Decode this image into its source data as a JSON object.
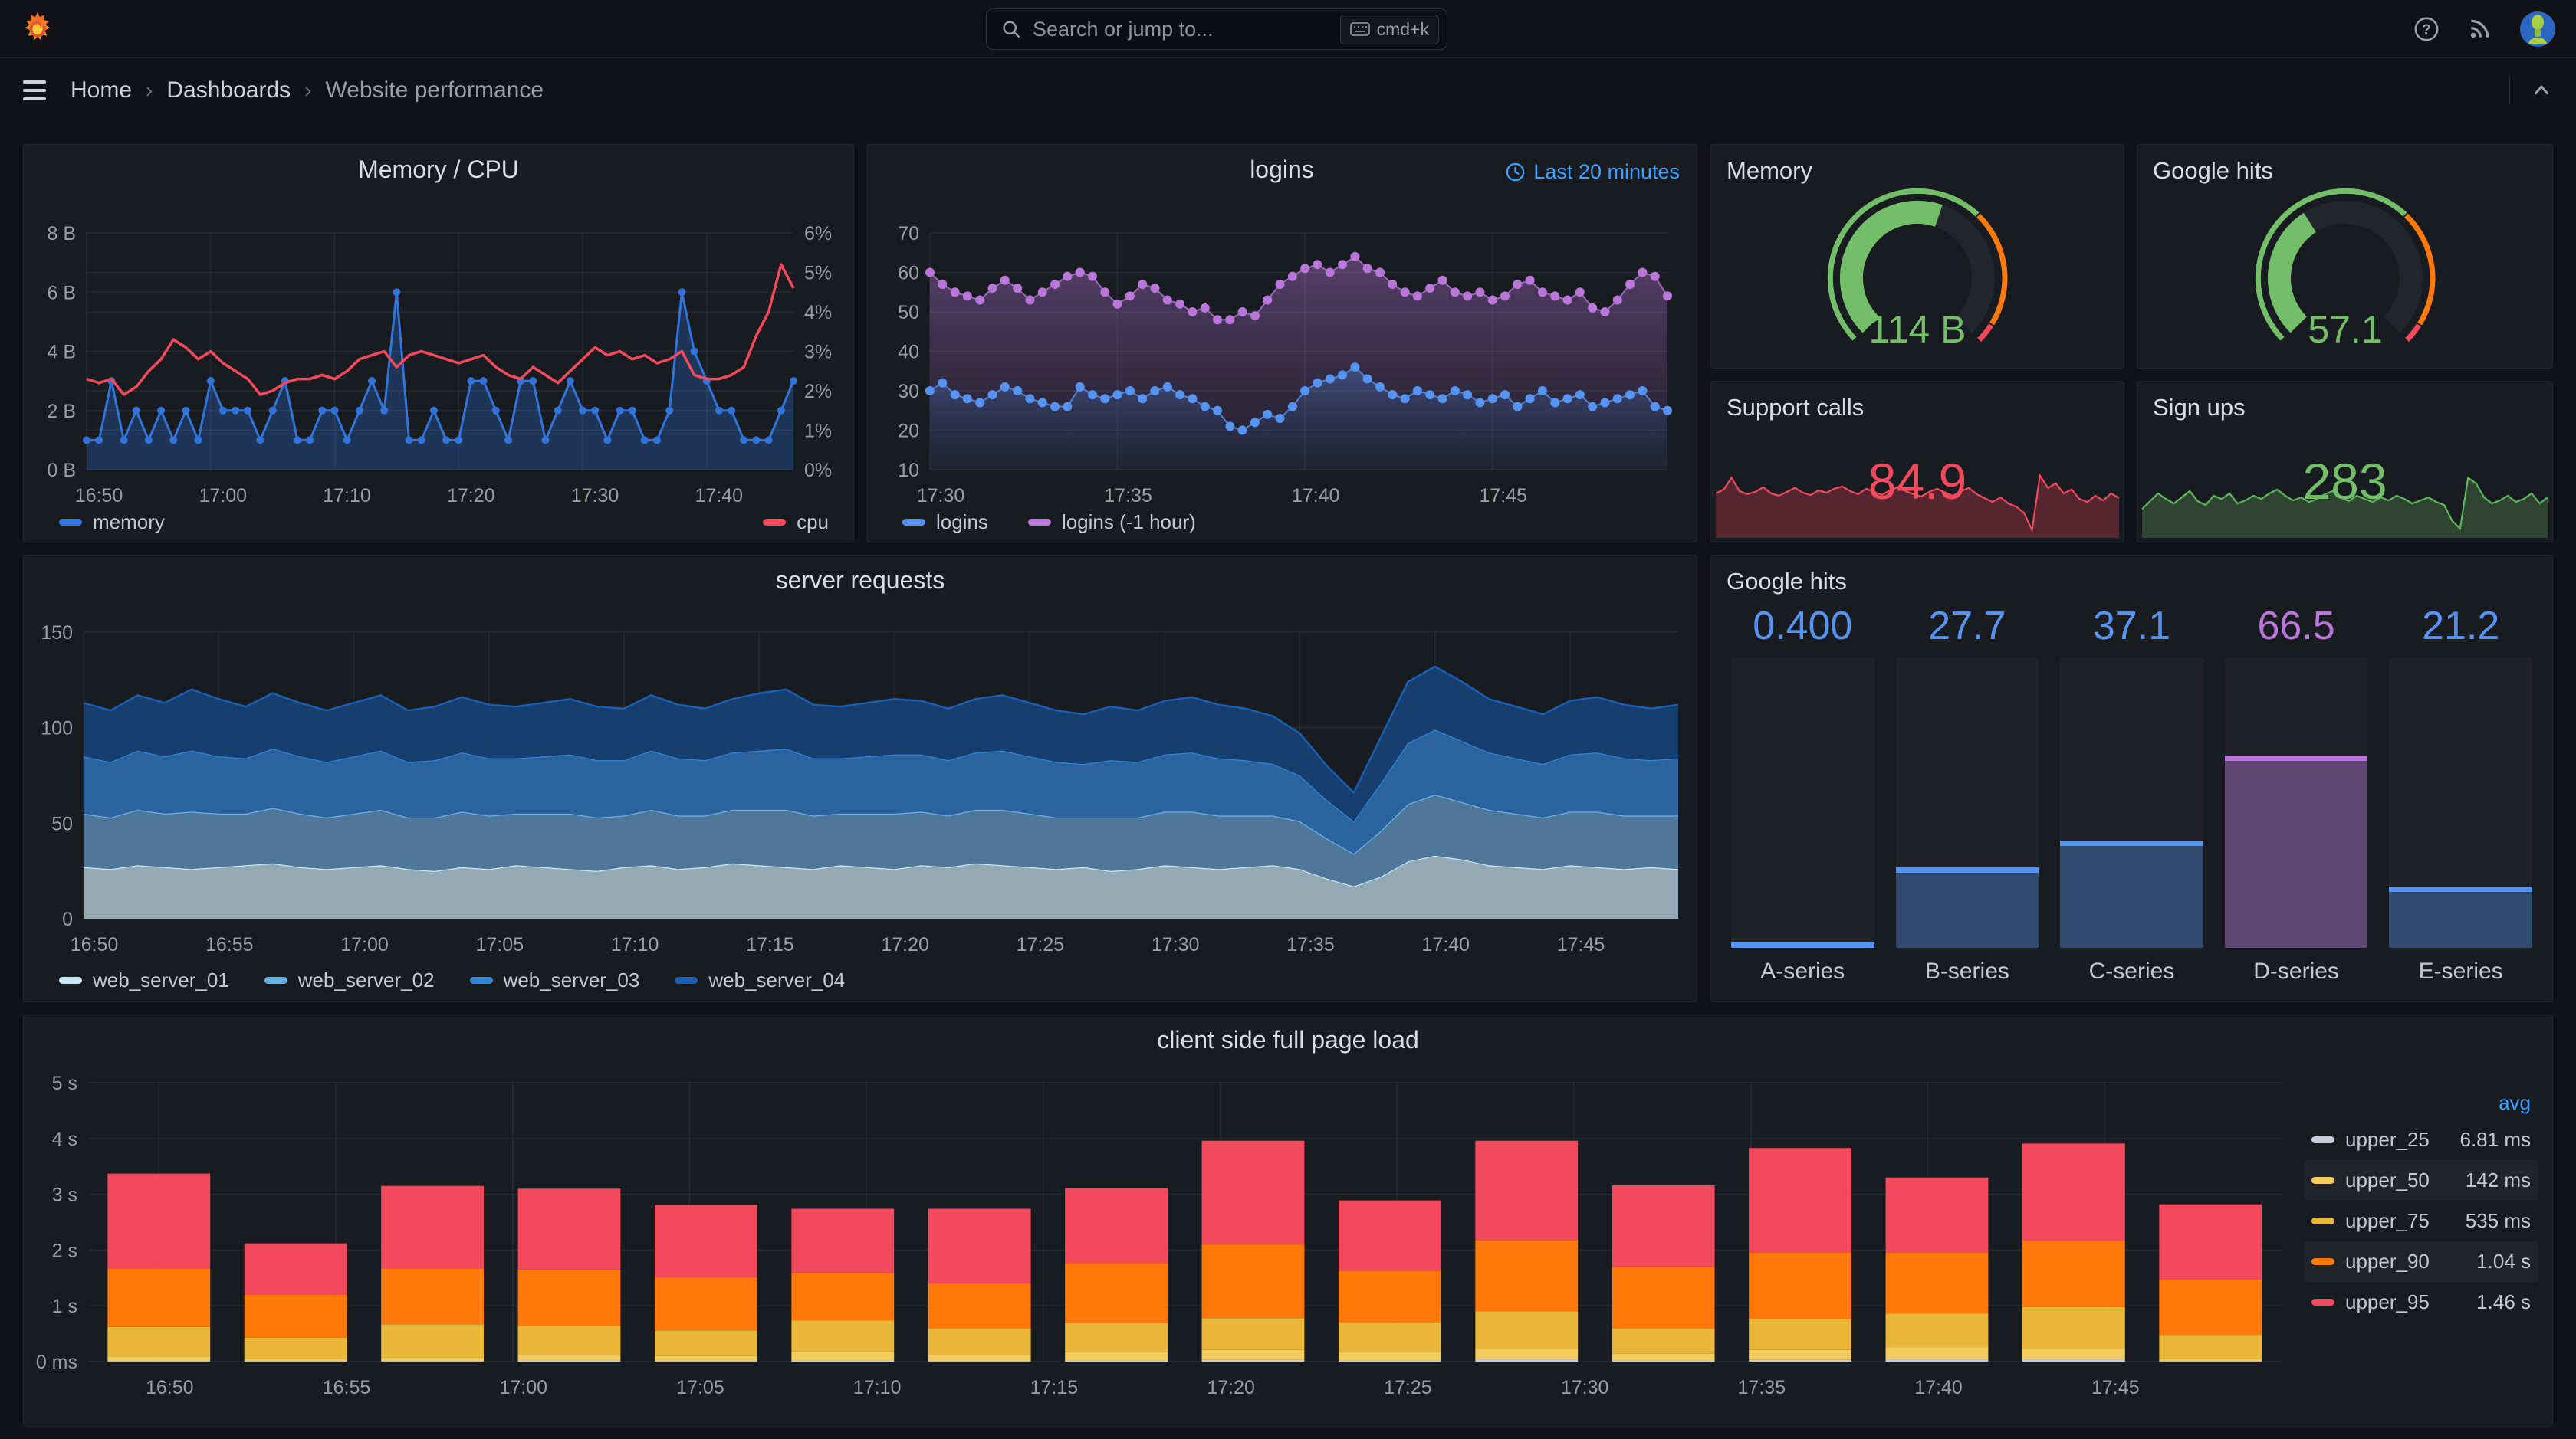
{
  "nav": {
    "search_placeholder": "Search or jump to...",
    "shortcut": "cmd+k"
  },
  "breadcrumb": {
    "sep": "›",
    "items": [
      "Home",
      "Dashboards",
      "Website performance"
    ]
  },
  "colors": {
    "page_bg": "#111217",
    "panel_bg": "#181B1F",
    "panel_border": "#25262C",
    "text": "#D8D9DA",
    "text_dim": "#9A9DA6",
    "grid": "rgba(204,204,220,0.09)",
    "link_blue": "#3CA1FF",
    "blue": "#3274D9",
    "light_blue": "#5794F2",
    "purple": "#B877D9",
    "red": "#F2495C",
    "green": "#73BF69",
    "orange": "#FF780A",
    "yellow": "#EAB839",
    "pale_yellow": "#F2CC5C",
    "pale": "#CCCCDC"
  },
  "panels": {
    "memcpu": {
      "title": "Memory / CPU",
      "legend": [
        {
          "label": "memory",
          "color": "#3274D9"
        },
        {
          "label": "cpu",
          "color": "#F2495C"
        }
      ]
    },
    "logins": {
      "title": "logins",
      "time_range": "Last 20 minutes",
      "legend": [
        {
          "label": "logins",
          "color": "#5794F2"
        },
        {
          "label": "logins (-1 hour)",
          "color": "#B877D9"
        }
      ]
    },
    "memory_gauge": {
      "title": "Memory",
      "value": "114 B"
    },
    "google_gauge": {
      "title": "Google hits",
      "value": "57.1"
    },
    "support_calls": {
      "title": "Support calls",
      "value": "84.9"
    },
    "sign_ups": {
      "title": "Sign ups",
      "value": "283"
    },
    "server_requests": {
      "title": "server requests",
      "legend": [
        {
          "label": "web_server_01",
          "color": "#C9E6F5"
        },
        {
          "label": "web_server_02",
          "color": "#68B2E8"
        },
        {
          "label": "web_server_03",
          "color": "#3186D6"
        },
        {
          "label": "web_server_04",
          "color": "#1B5FB0"
        }
      ]
    },
    "google_bars": {
      "title": "Google hits"
    },
    "client_load": {
      "title": "client side full page load",
      "legend_header": "avg",
      "legend": [
        {
          "label": "upper_25",
          "value": "6.81 ms",
          "color": "#CCCCDC",
          "zebra": false
        },
        {
          "label": "upper_50",
          "value": "142 ms",
          "color": "#F2CC5C",
          "zebra": true
        },
        {
          "label": "upper_75",
          "value": "535 ms",
          "color": "#EAB839",
          "zebra": false
        },
        {
          "label": "upper_90",
          "value": "1.04 s",
          "color": "#FF780A",
          "zebra": true
        },
        {
          "label": "upper_95",
          "value": "1.46 s",
          "color": "#F2495C",
          "zebra": false
        }
      ]
    }
  },
  "chart_data": {
    "memcpu": {
      "type": "line",
      "title": "Memory / CPU",
      "x_ticks": {
        "idx": [
          0,
          10,
          20,
          30,
          40,
          50
        ],
        "labels": [
          "16:50",
          "17:00",
          "17:10",
          "17:20",
          "17:30",
          "17:40"
        ]
      },
      "y_left": {
        "min": 0,
        "max": 8,
        "tick_labels": [
          "0 B",
          "2 B",
          "4 B",
          "6 B",
          "8 B"
        ]
      },
      "y_right": {
        "min": 0,
        "max": 6,
        "tick_labels": [
          "0%",
          "1%",
          "2%",
          "3%",
          "4%",
          "5%",
          "6%"
        ]
      },
      "series": [
        {
          "name": "memory",
          "unit": "B",
          "axis": "left",
          "color": "#3274D9",
          "fill": "rgba(50,116,217,0.30)",
          "values": [
            1,
            1,
            3,
            1,
            2,
            1,
            2,
            1,
            2,
            1,
            3,
            2,
            2,
            2,
            1,
            2,
            3,
            1,
            1,
            2,
            2,
            1,
            2,
            3,
            2,
            6,
            1,
            1,
            2,
            1,
            1,
            3,
            3,
            2,
            1,
            3,
            3,
            1,
            2,
            3,
            2,
            2,
            1,
            2,
            2,
            1,
            1,
            2,
            6,
            4,
            3,
            2,
            2,
            1,
            1,
            1,
            2,
            3
          ]
        },
        {
          "name": "cpu",
          "unit": "%",
          "axis": "right",
          "color": "#F2495C",
          "values": [
            2.3,
            2.2,
            2.3,
            1.9,
            2.1,
            2.5,
            2.8,
            3.3,
            3.1,
            2.8,
            3.0,
            2.7,
            2.5,
            2.3,
            1.9,
            2.0,
            2.2,
            2.3,
            2.3,
            2.4,
            2.3,
            2.5,
            2.8,
            2.9,
            3.0,
            2.6,
            2.9,
            3.0,
            2.9,
            2.8,
            2.7,
            2.8,
            2.9,
            2.6,
            2.4,
            2.3,
            2.6,
            2.4,
            2.2,
            2.5,
            2.8,
            3.1,
            2.9,
            3.0,
            2.8,
            2.9,
            2.7,
            2.8,
            3.0,
            2.4,
            2.3,
            2.3,
            2.4,
            2.6,
            3.4,
            4.0,
            5.2,
            4.6
          ]
        }
      ]
    },
    "logins": {
      "type": "points",
      "title": "logins",
      "x_ticks": {
        "idx": [
          0,
          15,
          30,
          45
        ],
        "labels": [
          "17:30",
          "17:35",
          "17:40",
          "17:45"
        ]
      },
      "y": {
        "min": 10,
        "max": 70,
        "tick_labels": [
          "10",
          "20",
          "30",
          "40",
          "50",
          "60",
          "70"
        ]
      },
      "series": [
        {
          "name": "logins (-1 hour)",
          "color": "#B877D9",
          "values": [
            60,
            57,
            55,
            54,
            53,
            56,
            58,
            56,
            53,
            55,
            57,
            59,
            60,
            59,
            55,
            52,
            54,
            57,
            56,
            53,
            52,
            50,
            51,
            48,
            48,
            50,
            49,
            53,
            57,
            59,
            61,
            62,
            60,
            62,
            64,
            61,
            60,
            57,
            55,
            54,
            56,
            58,
            55,
            54,
            55,
            53,
            54,
            57,
            58,
            55,
            54,
            53,
            55,
            51,
            50,
            53,
            57,
            60,
            59,
            54
          ]
        },
        {
          "name": "logins",
          "color": "#5794F2",
          "values": [
            30,
            32,
            29,
            28,
            27,
            29,
            31,
            30,
            28,
            27,
            26,
            26,
            31,
            29,
            28,
            29,
            30,
            28,
            30,
            31,
            29,
            28,
            26,
            25,
            21,
            20,
            22,
            24,
            23,
            26,
            30,
            32,
            33,
            34,
            36,
            33,
            31,
            29,
            28,
            30,
            29,
            28,
            30,
            29,
            27,
            28,
            29,
            26,
            28,
            30,
            27,
            28,
            29,
            26,
            27,
            28,
            29,
            30,
            26,
            25
          ]
        }
      ]
    },
    "memory_gauge": {
      "type": "gauge",
      "display": "114 B",
      "percent": 0.57,
      "color": "#73BF69",
      "thresholds": [
        {
          "upTo": 0.66,
          "color": "#73BF69"
        },
        {
          "upTo": 0.95,
          "color": "#FF780A"
        },
        {
          "upTo": 1.0,
          "color": "#F2495C"
        }
      ]
    },
    "google_gauge": {
      "type": "gauge",
      "display": "57.1",
      "percent": 0.38,
      "color": "#73BF69",
      "thresholds": [
        {
          "upTo": 0.66,
          "color": "#73BF69"
        },
        {
          "upTo": 0.95,
          "color": "#FF780A"
        },
        {
          "upTo": 1.0,
          "color": "#F2495C"
        }
      ]
    },
    "support_calls": {
      "type": "sparkline",
      "color": "#F2495C",
      "fill": "rgba(242,73,92,0.28)",
      "values": [
        55,
        60,
        75,
        58,
        54,
        57,
        63,
        55,
        52,
        57,
        62,
        56,
        53,
        59,
        56,
        61,
        64,
        58,
        54,
        61,
        57,
        53,
        59,
        63,
        58,
        54,
        51,
        57,
        61,
        56,
        52,
        58,
        62,
        54,
        49,
        44,
        50,
        42,
        38,
        30,
        8,
        78,
        62,
        68,
        55,
        60,
        48,
        44,
        52,
        46,
        55,
        49
      ]
    },
    "sign_ups": {
      "type": "sparkline",
      "color": "#5CB85C",
      "fill": "rgba(115,191,105,0.25)",
      "values": [
        35,
        45,
        55,
        48,
        42,
        50,
        58,
        45,
        40,
        52,
        48,
        55,
        42,
        46,
        52,
        48,
        55,
        60,
        52,
        46,
        50,
        44,
        48,
        54,
        58,
        50,
        45,
        52,
        48,
        44,
        50,
        46,
        52,
        48,
        42,
        46,
        50,
        44,
        40,
        20,
        10,
        75,
        68,
        50,
        42,
        46,
        52,
        44,
        48,
        55,
        42,
        50
      ]
    },
    "server_requests": {
      "type": "stacked_area",
      "title": "server requests",
      "x_ticks": {
        "idx": [
          0,
          5,
          10,
          15,
          20,
          25,
          30,
          35,
          40,
          45,
          50,
          55
        ],
        "labels": [
          "16:50",
          "16:55",
          "17:00",
          "17:05",
          "17:10",
          "17:15",
          "17:20",
          "17:25",
          "17:30",
          "17:35",
          "17:40",
          "17:45"
        ]
      },
      "y": {
        "min": 0,
        "max": 150,
        "tick_labels": [
          "0",
          "50",
          "100",
          "150"
        ]
      },
      "series": [
        {
          "name": "web_server_01",
          "line": "#C9E6F5",
          "fill": "#93A9B6",
          "values": [
            27,
            26,
            28,
            27,
            26,
            27,
            28,
            29,
            27,
            26,
            27,
            28,
            26,
            25,
            27,
            26,
            28,
            27,
            26,
            25,
            27,
            28,
            26,
            27,
            29,
            28,
            27,
            26,
            28,
            27,
            26,
            28,
            27,
            29,
            28,
            27,
            26,
            27,
            25,
            26,
            28,
            27,
            26,
            27,
            28,
            26,
            21,
            17,
            22,
            30,
            33,
            31,
            28,
            27,
            26,
            28,
            27,
            26,
            27,
            26
          ]
        },
        {
          "name": "web_server_02",
          "line": "#68B2E8",
          "fill": "#4F7799",
          "values": [
            28,
            27,
            29,
            28,
            30,
            28,
            27,
            29,
            28,
            27,
            28,
            29,
            27,
            28,
            29,
            28,
            27,
            28,
            29,
            28,
            27,
            29,
            28,
            27,
            28,
            29,
            30,
            28,
            27,
            28,
            29,
            28,
            27,
            28,
            29,
            28,
            27,
            26,
            28,
            27,
            28,
            29,
            28,
            27,
            26,
            25,
            21,
            17,
            24,
            30,
            32,
            30,
            29,
            28,
            27,
            28,
            29,
            28,
            27,
            28
          ]
        },
        {
          "name": "web_server_03",
          "line": "#3186D6",
          "fill": "#2B639E",
          "values": [
            30,
            29,
            31,
            30,
            32,
            30,
            29,
            31,
            30,
            29,
            30,
            31,
            29,
            30,
            31,
            30,
            29,
            30,
            31,
            30,
            29,
            31,
            30,
            29,
            30,
            31,
            32,
            30,
            29,
            30,
            31,
            30,
            29,
            30,
            31,
            30,
            29,
            28,
            30,
            29,
            30,
            31,
            30,
            29,
            27,
            24,
            20,
            17,
            25,
            32,
            34,
            32,
            30,
            29,
            28,
            30,
            31,
            30,
            29,
            30
          ]
        },
        {
          "name": "web_server_04",
          "line": "#1B5FB0",
          "fill": "#163E6F",
          "values": [
            28,
            27,
            29,
            28,
            32,
            30,
            27,
            29,
            28,
            27,
            28,
            29,
            27,
            28,
            29,
            28,
            27,
            28,
            29,
            28,
            27,
            29,
            28,
            27,
            28,
            30,
            31,
            28,
            27,
            28,
            29,
            28,
            27,
            28,
            29,
            28,
            27,
            26,
            28,
            27,
            28,
            29,
            28,
            27,
            25,
            22,
            18,
            15,
            24,
            32,
            33,
            31,
            28,
            27,
            26,
            28,
            29,
            28,
            27,
            28
          ]
        }
      ]
    },
    "google_bars": {
      "type": "bar_gauge",
      "title": "Google hits",
      "max": 100,
      "categories": [
        "A-series",
        "B-series",
        "C-series",
        "D-series",
        "E-series"
      ],
      "values": [
        0.4,
        27.7,
        37.1,
        66.5,
        21.2
      ],
      "display_values": [
        "0.400",
        "27.7",
        "37.1",
        "66.5",
        "21.2"
      ],
      "colors": [
        "#5794F2",
        "#5794F2",
        "#5794F2",
        "#B877D9",
        "#5794F2"
      ],
      "fills": [
        "rgba(87,148,242,0.35)",
        "rgba(87,148,242,0.35)",
        "rgba(87,148,242,0.35)",
        "rgba(184,119,217,0.42)",
        "rgba(87,148,242,0.35)"
      ]
    },
    "client_load": {
      "type": "stacked_bar",
      "title": "client side full page load",
      "y": {
        "min": 0,
        "max": 5,
        "tick_labels": [
          "0 ms",
          "1 s",
          "2 s",
          "3 s",
          "4 s",
          "5 s"
        ]
      },
      "x_tick_minutes": [
        0,
        5,
        10,
        15,
        20,
        25,
        30,
        35,
        40,
        45,
        50,
        55
      ],
      "x_tick_labels": [
        "16:50",
        "16:55",
        "17:00",
        "17:05",
        "17:10",
        "17:15",
        "17:20",
        "17:25",
        "17:30",
        "17:35",
        "17:40",
        "17:45"
      ],
      "bar_interval_min": 3.866,
      "bar_width_min": 2.9,
      "series": [
        {
          "name": "upper_25",
          "color": "#CCCCDC",
          "cumulative": [
            0.01,
            0.01,
            0.01,
            0.02,
            0.01,
            0.02,
            0.01,
            0.02,
            0.03,
            0.02,
            0.04,
            0.02,
            0.03,
            0.04,
            0.04,
            0.01
          ]
        },
        {
          "name": "upper_50",
          "color": "#F2CC5C",
          "cumulative": [
            0.09,
            0.05,
            0.07,
            0.12,
            0.1,
            0.18,
            0.12,
            0.17,
            0.21,
            0.17,
            0.24,
            0.14,
            0.21,
            0.26,
            0.24,
            0.05
          ]
        },
        {
          "name": "upper_75",
          "color": "#EAB839",
          "cumulative": [
            0.62,
            0.43,
            0.67,
            0.64,
            0.56,
            0.74,
            0.59,
            0.69,
            0.78,
            0.7,
            0.9,
            0.59,
            0.76,
            0.86,
            0.98,
            0.48
          ]
        },
        {
          "name": "upper_90",
          "color": "#FF780A",
          "cumulative": [
            1.67,
            1.2,
            1.67,
            1.65,
            1.51,
            1.58,
            1.4,
            1.77,
            2.1,
            1.63,
            2.18,
            1.69,
            1.96,
            1.96,
            2.17,
            1.48
          ]
        },
        {
          "name": "upper_95",
          "color": "#F2495C",
          "cumulative": [
            3.37,
            2.12,
            3.15,
            3.1,
            2.81,
            2.74,
            2.74,
            3.11,
            3.96,
            2.89,
            3.96,
            3.16,
            3.83,
            3.3,
            3.91,
            2.82
          ]
        }
      ],
      "avg": {
        "upper_25": "6.81 ms",
        "upper_50": "142 ms",
        "upper_75": "535 ms",
        "upper_90": "1.04 s",
        "upper_95": "1.46 s"
      }
    }
  }
}
